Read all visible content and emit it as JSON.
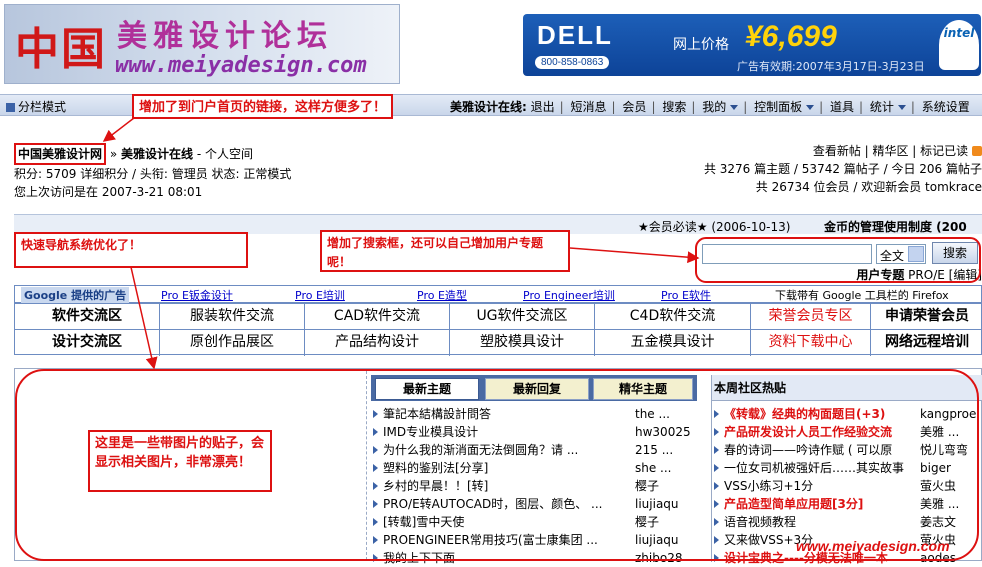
{
  "header": {
    "logo_cn_big": "中国",
    "logo_cn_name": "美雅设计论坛",
    "logo_url": "www.meiyadesign.com"
  },
  "ad": {
    "brand": "DELL",
    "phone": "800-858-0863",
    "price_label": "网上价格",
    "price": "¥6,699",
    "validity": "广告有效期:2007年3月17日-3月23日",
    "intel_label": "intel"
  },
  "menubar": {
    "fen_label": "分栏模式",
    "online_label": "美雅设计在线:",
    "items": [
      "退出",
      "短消息",
      "会员",
      "搜索",
      "我的",
      "控制面板",
      "道具",
      "统计",
      "系统设置"
    ]
  },
  "userinfo": {
    "site_link": "中国美雅设计网",
    "sep": "»",
    "online": "美雅设计在线",
    "space": "- 个人空间",
    "points_line": "积分: 5709 详细积分 / 头衔: 管理员 状态: 正常模式",
    "last_visit": "您上次访问是在 2007-3-21 08:01"
  },
  "stats": {
    "links_line": "查看新帖 | 精华区 | 标记已读",
    "line1": "共 3276 篇主题 / 53742 篇帖子 / 今日 206 篇帖子",
    "line2": "共 26734 位会员 / 欢迎新会员 tomkrace"
  },
  "notice": {
    "item1": "★会员必读★ (2006-10-13)",
    "item2": "金币的管理使用制度 (200"
  },
  "search": {
    "select_value": "全文",
    "button": "搜索",
    "topic_label": "用户专题",
    "topic_value": "PRO/E [编辑]"
  },
  "linkrow": {
    "gads": "Google 提供的广告",
    "links": [
      "Pro E钣金设计",
      "Pro E培训",
      "Pro E造型",
      "Pro Engineer培训",
      "Pro E软件"
    ],
    "firefox": "下载带有 Google 工具栏的 Firefox"
  },
  "nav": {
    "row1": [
      "软件交流区",
      "服装软件交流",
      "CAD软件交流",
      "UG软件交流区",
      "C4D软件交流",
      "荣誉会员专区",
      "申请荣誉会员"
    ],
    "row2": [
      "设计交流区",
      "原创作品展区",
      "产品结构设计",
      "塑胶模具设计",
      "五金模具设计",
      "资料下载中心",
      "网络远程培训"
    ]
  },
  "tabs": [
    "最新主题",
    "最新回复",
    "精华主题"
  ],
  "topics": [
    {
      "title": "筆記本結構設計問答",
      "author": "the ..."
    },
    {
      "title": "IMD专业模具设计",
      "author": "hw30025"
    },
    {
      "title": "为什么我的渐消面无法倒圆角？请 ...",
      "author": "215 ..."
    },
    {
      "title": "塑料的鉴别法[分享]",
      "author": "she ..."
    },
    {
      "title": "乡村的早晨！！[转]",
      "author": "樱子"
    },
    {
      "title": "PRO/E转AUTOCAD时，图层、颜色、 ...",
      "author": "liujiaqu"
    },
    {
      "title": "[转载]雪中天使",
      "author": "樱子"
    },
    {
      "title": "PROENGINEER常用技巧(富士康集团 ...",
      "author": "liujiaqu"
    },
    {
      "title": "我的上下下面",
      "author": "zhibo28"
    }
  ],
  "hot": {
    "title": "本周社区热贴",
    "items": [
      {
        "title": "《转载》经典的构面题目(+3)",
        "author": "kangproe",
        "red": true
      },
      {
        "title": "产品研发设计人员工作经验交流",
        "author": "美雅 ...",
        "red": true
      },
      {
        "title": "春的诗词——吟诗作赋 ( 可以原",
        "author": "悦儿弯弯",
        "red": false
      },
      {
        "title": "一位女司机被强奸后……其实故事",
        "author": "biger",
        "red": false
      },
      {
        "title": "VSS小练习+1分",
        "author": "萤火虫",
        "red": false
      },
      {
        "title": "产品造型简单应用题[3分]",
        "author": "美雅 ...",
        "red": true
      },
      {
        "title": "语音视频教程",
        "author": "姜志文",
        "red": false
      },
      {
        "title": "又来做VSS+3分",
        "author": "萤火虫",
        "red": false
      },
      {
        "title": "设计宝典之----分模无法唯一本",
        "author": "aodes",
        "red": true
      }
    ]
  },
  "annotations": {
    "a1": "增加了到门户首页的链接，这样方便多了！",
    "a2": "快速导航系统优化了！",
    "a3": "增加了搜索框，还可以自己增加用户专题呢！",
    "a4": "这里是一些带图片的贴子，会显示相关图片，非常漂亮！"
  },
  "watermark": "www.meiyadesign.com",
  "colors": {
    "annotation_red": "#dd1111",
    "menu_blue": "#c9d6ea",
    "link_blue": "#0000cc"
  }
}
